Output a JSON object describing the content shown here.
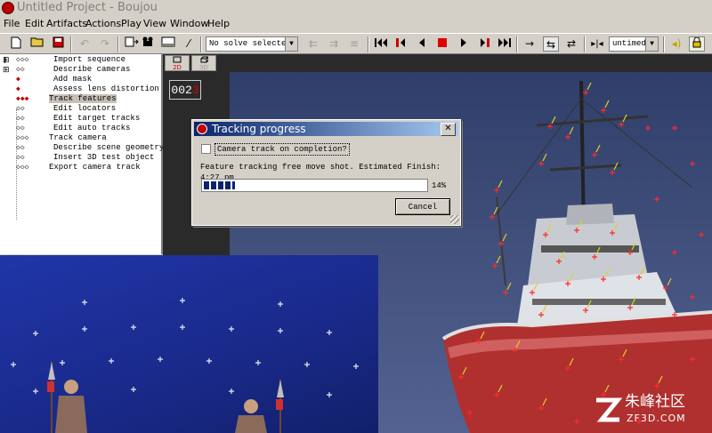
{
  "window": {
    "title": "Untitled Project - Boujou"
  },
  "menu": [
    "File",
    "Edit",
    "Artifacts",
    "Actions",
    "Play",
    "View",
    "Window",
    "Help"
  ],
  "toolbar": {
    "solve_select": "No solve selected",
    "timing_select": "untimed",
    "icons": [
      "new-icon",
      "open-icon",
      "save-icon",
      "undo-icon",
      "redo-icon",
      "export-film-icon",
      "camera-icon",
      "view-icon",
      "wand-icon",
      "solve-prev-icon",
      "solve-next-icon",
      "solve-all-icon",
      "first-frame-icon",
      "prev-key-icon",
      "step-back-icon",
      "stop-icon",
      "play-icon",
      "next-key-icon",
      "last-frame-icon",
      "arrow-forward-icon",
      "loop-icon",
      "ping-pong-icon",
      "range-icon",
      "sound-icon",
      "lock-icon"
    ]
  },
  "tasks": [
    {
      "label": "Import sequence",
      "state": "pending",
      "marker": "◇◇◇"
    },
    {
      "label": "Describe cameras",
      "state": "pending",
      "marker": "◇◇"
    },
    {
      "label": "Add mask",
      "state": "done",
      "marker": "◆"
    },
    {
      "label": "Assess lens distortion",
      "state": "done",
      "marker": "◆"
    },
    {
      "label": "Track features",
      "state": "active",
      "marker": "◆◆◆"
    },
    {
      "label": "Edit locators",
      "state": "pending",
      "marker": "◇◇"
    },
    {
      "label": "Edit target tracks",
      "state": "pending",
      "marker": "◇◇"
    },
    {
      "label": "Edit auto tracks",
      "state": "pending",
      "marker": "◇◇"
    },
    {
      "label": "Track camera",
      "state": "pending",
      "marker": "◇◇◇"
    },
    {
      "label": "Describe scene geometry",
      "state": "pending",
      "marker": "◇◇"
    },
    {
      "label": "Insert 3D test object",
      "state": "pending",
      "marker": "◇◇"
    },
    {
      "label": "Export camera track",
      "state": "pending",
      "marker": "◇◇◇"
    }
  ],
  "viewer": {
    "tabs": [
      "2D",
      "3D"
    ],
    "frame_prefix": "002",
    "frame_digit": "3"
  },
  "dialog": {
    "title": "Tracking progress",
    "checkbox_label": "Camera track on completion?",
    "checkbox_checked": false,
    "status": "Feature tracking free move shot. Estimated Finish: 4:27 pm",
    "progress": 0.14,
    "percent_label": "14%",
    "cancel_label": "Cancel"
  },
  "watermark": {
    "cn": "朱峰社区",
    "domain": "ZF3D.COM"
  },
  "colors": {
    "track_marker": "#ff2a2a",
    "track_trail": "#e0d020",
    "selection": "#c8c0b8",
    "progress": "#0a246a"
  }
}
